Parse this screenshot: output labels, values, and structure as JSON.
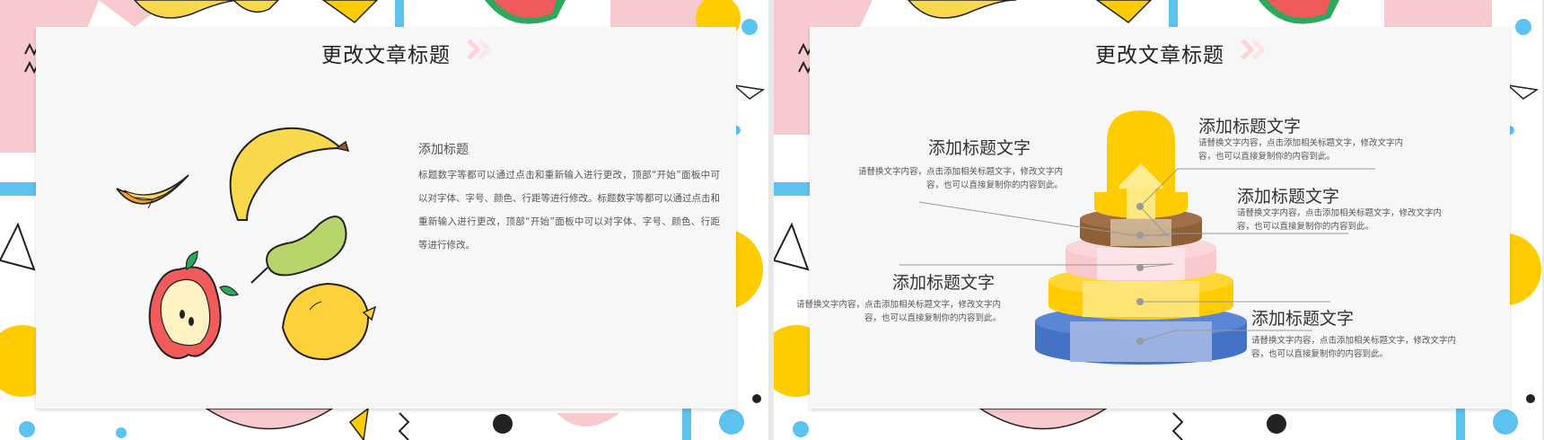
{
  "slide1": {
    "title": "更改文章标题",
    "subheading": "添加标题",
    "paragraph": "标题数字等都可以通过点击和重新输入进行更改，顶部“开始”面板中可以对字体、字号、颜色、行距等进行修改。标题数字等都可以通过点击和重新输入进行更改，顶部“开始”面板中可以对字体、字号、颜色、行距等进行修改。"
  },
  "slide2": {
    "title": "更改文章标题",
    "labels": [
      {
        "heading": "添加标题文字",
        "text": "请替换文字内容，点击添加相关标题文字，修改文字内容，也可以直接复制你的内容到此。"
      },
      {
        "heading": "添加标题文字",
        "text": "请替换文字内容，点击添加相关标题文字，修改文字内容，也可以直接复制你的内容到此。"
      },
      {
        "heading": "添加标题文字",
        "text": "请替换文字内容，点击添加相关标题文字，修改文字内容，也可以直接复制你的内容到此。"
      },
      {
        "heading": "添加标题文字",
        "text": "请替换文字内容，点击添加相关标题文字，修改文字内容，也可以直接复制你的内容到此。"
      },
      {
        "heading": "添加标题文字",
        "text": "请替换文字内容，点击添加相关标题文字，修改文字内容，也可以直接复制你的内容到此。"
      }
    ]
  },
  "colors": {
    "yellow": "#ffcc00",
    "pink": "#f8c9cf",
    "sky_blue": "#5cc3ee",
    "brown": "#8e6038",
    "royal_blue": "#4472c4",
    "pale_blue": "#9fb4e3"
  }
}
